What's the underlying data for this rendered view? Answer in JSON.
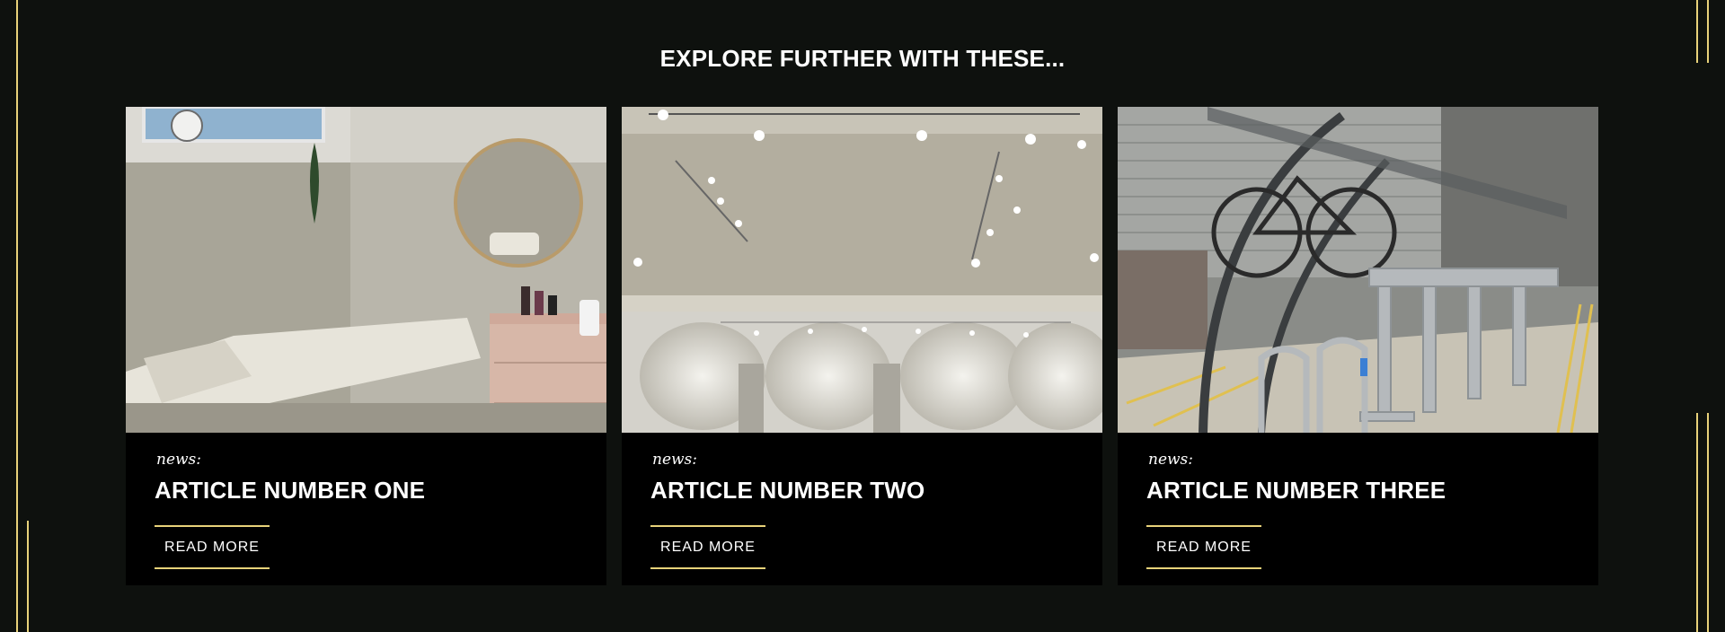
{
  "section": {
    "title": "EXPLORE FURTHER WITH THESE..."
  },
  "colors": {
    "background": "#0e110e",
    "card": "#000000",
    "accent_gold": "#e8d27a",
    "text": "#ffffff"
  },
  "cards": [
    {
      "category": "news:",
      "title": "ARTICLE NUMBER ONE",
      "read_more": "READ MORE",
      "image": "treatment-room-photo"
    },
    {
      "category": "news:",
      "title": "ARTICLE NUMBER TWO",
      "read_more": "READ MORE",
      "image": "gallery-lighting-photo"
    },
    {
      "category": "news:",
      "title": "ARTICLE NUMBER THREE",
      "read_more": "READ MORE",
      "image": "bike-shelter-photo"
    }
  ]
}
